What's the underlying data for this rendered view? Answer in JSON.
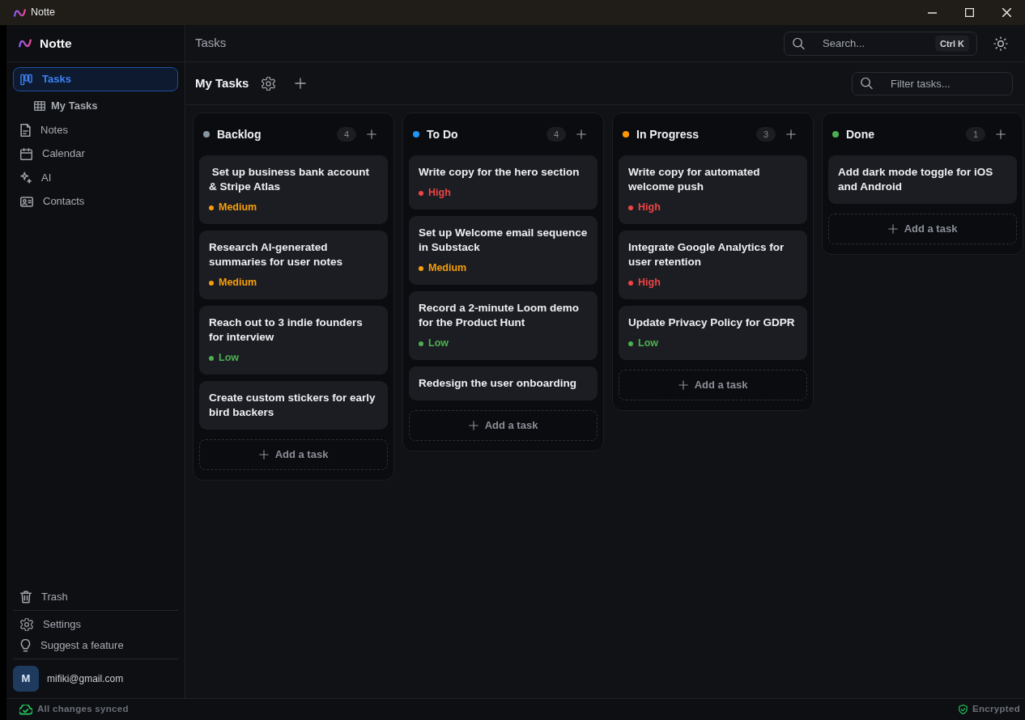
{
  "window": {
    "title": "Notte"
  },
  "sidebar": {
    "brand": "Notte",
    "items": [
      {
        "label": "Tasks",
        "selected": true,
        "children": [
          {
            "label": "My Tasks",
            "selected": false
          }
        ]
      },
      {
        "label": "Notes",
        "selected": false
      },
      {
        "label": "Calendar",
        "selected": false
      },
      {
        "label": "AI",
        "selected": false
      },
      {
        "label": "Contacts",
        "selected": false
      }
    ],
    "footer_groups": [
      [
        {
          "label": "Trash"
        }
      ],
      [
        {
          "label": "Settings"
        },
        {
          "label": "Suggest a feature"
        }
      ]
    ],
    "account": {
      "avatar": "M",
      "email": "mifiki@gmail.com"
    }
  },
  "header": {
    "title": "Tasks",
    "search": {
      "placeholder": "Search...",
      "shortcut": "Ctrl K"
    }
  },
  "board": {
    "title": "My Tasks",
    "filter": {
      "placeholder": "Filter tasks..."
    },
    "columns": [
      {
        "title": "Backlog",
        "color": "#8696a0",
        "count": "4",
        "cards": [
          {
            "title": " Set up business bank account & Stripe Atlas",
            "priority": {
              "label": "Medium",
              "color": "#f59e0b"
            }
          },
          {
            "title": "Research AI-generated summaries for user notes",
            "priority": {
              "label": "Medium",
              "color": "#f59e0b"
            }
          },
          {
            "title": "Reach out to 3 indie founders for interview",
            "priority": {
              "label": "Low",
              "color": "#4caf50"
            }
          },
          {
            "title": "Create custom stickers for early bird backers"
          }
        ],
        "add_label": "Add a task"
      },
      {
        "title": "To Do",
        "color": "#2196f3",
        "count": "4",
        "cards": [
          {
            "title": "Write copy for the hero section",
            "priority": {
              "label": "High",
              "color": "#ef4444"
            }
          },
          {
            "title": "Set up Welcome email sequence in Substack",
            "priority": {
              "label": "Medium",
              "color": "#f59e0b"
            }
          },
          {
            "title": "Record a 2-minute Loom demo for the Product Hunt",
            "priority": {
              "label": "Low",
              "color": "#4caf50"
            }
          },
          {
            "title": "Redesign the user onboarding"
          }
        ],
        "add_label": "Add a task"
      },
      {
        "title": "In Progress",
        "color": "#ff9800",
        "count": "3",
        "cards": [
          {
            "title": "Write copy for automated welcome push",
            "priority": {
              "label": "High",
              "color": "#ef4444"
            }
          },
          {
            "title": "Integrate Google Analytics for user retention",
            "priority": {
              "label": "High",
              "color": "#ef4444"
            }
          },
          {
            "title": "Update Privacy Policy for GDPR",
            "priority": {
              "label": "Low",
              "color": "#4caf50"
            }
          }
        ],
        "add_label": "Add a task"
      },
      {
        "title": "Done",
        "color": "#4caf50",
        "count": "1",
        "cards": [
          {
            "title": "Add dark mode toggle for iOS and Android"
          }
        ],
        "add_label": "Add a task"
      }
    ]
  },
  "status_bar": {
    "sync": "All changes synced",
    "security": "Encrypted"
  }
}
